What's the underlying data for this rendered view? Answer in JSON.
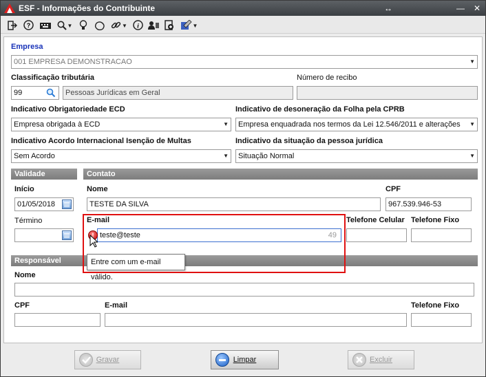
{
  "window": {
    "title": "ESF - Informações do Contribuinte",
    "controls": {
      "restore": "↔",
      "minimize": "—",
      "close": "✕"
    }
  },
  "toolbar": {
    "icons": [
      "exit-icon",
      "help-icon",
      "keyboard-icon",
      "search-icon",
      "lightbulb-icon",
      "map-icon",
      "link-icon",
      "info-icon",
      "user-card-icon",
      "add-document-icon",
      "settings-icon"
    ]
  },
  "empresa": {
    "label": "Empresa",
    "value": "001 EMPRESA DEMONSTRACAO"
  },
  "classificacao": {
    "label": "Classificação tributária",
    "code": "99",
    "description": "Pessoas Jurídicas em Geral"
  },
  "recibo": {
    "label": "Número de recibo",
    "value": ""
  },
  "ecd": {
    "label": "Indicativo Obrigatoriedade ECD",
    "value": "Empresa obrigada à ECD"
  },
  "desoneracao": {
    "label": "Indicativo de desoneração da  Folha pela CPRB",
    "value": "Empresa enquadrada nos termos da Lei 12.546/2011 e alterações"
  },
  "acordo": {
    "label": "Indicativo Acordo Internacional Isenção de Multas",
    "value": "Sem Acordo"
  },
  "situacao": {
    "label": "Indicativo da situação da pessoa jurídica",
    "value": "Situação Normal"
  },
  "validade": {
    "header": "Validade",
    "inicio_label": "Início",
    "inicio_value": "01/05/2018",
    "termino_label": "Término",
    "termino_value": ""
  },
  "contato": {
    "header": "Contato",
    "nome_label": "Nome",
    "nome_value": "TESTE DA SILVA",
    "cpf_label": "CPF",
    "cpf_value": "967.539.946-53",
    "email_label": "E-mail",
    "email_value": "teste@teste",
    "email_counter": "49",
    "email_error": "Entre com um e-mail válido.",
    "celular_label": "Telefone Celular",
    "celular_value": "",
    "fixo_label": "Telefone Fixo",
    "fixo_value": ""
  },
  "responsavel": {
    "header": "Responsável",
    "nome_label": "Nome",
    "nome_value": "",
    "cpf_label": "CPF",
    "cpf_value": "",
    "email_label": "E-mail",
    "email_value": "",
    "fixo_label": "Telefone Fixo",
    "fixo_value": ""
  },
  "buttons": {
    "gravar": "Gravar",
    "limpar": "Limpar",
    "excluir": "Excluir"
  },
  "colors": {
    "highlight": "#e01010",
    "title_blue": "#1832b8"
  }
}
